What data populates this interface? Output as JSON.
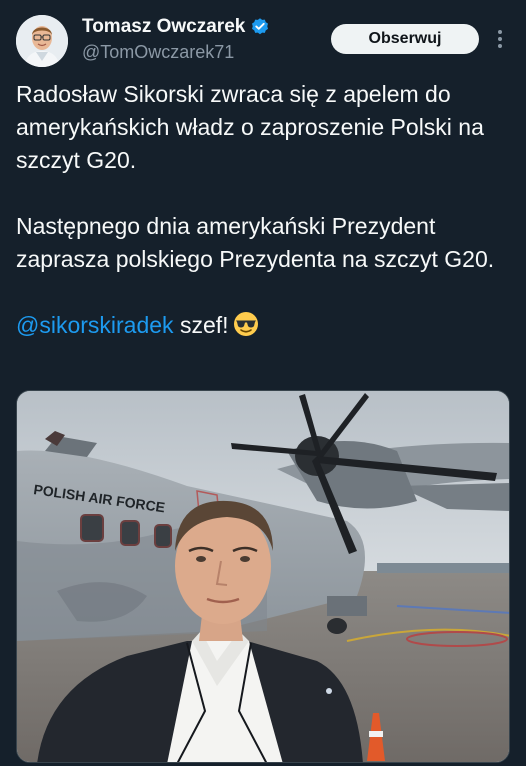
{
  "author": {
    "name": "Tomasz Owczarek",
    "handle": "@TomOwczarek71",
    "verified": true,
    "verified_color": "#1d9bf0"
  },
  "actions": {
    "follow_label": "Obserwuj"
  },
  "tweet": {
    "paragraph1": "Radosław Sikorski zwraca się z apelem do amerykańskich władz o zaproszenie Polski na szczyt G20.",
    "paragraph2": "Następnego dnia amerykański Prezydent zaprasza polskiego Prezydenta na szczyt G20.",
    "mention": "@sikorskiradek",
    "paragraph3_rest": " szef!",
    "emoji": "smiling-face-with-sunglasses"
  },
  "media": {
    "aircraft_text": "POLISH AIR FORCE"
  },
  "colors": {
    "background": "#15202b",
    "text": "#f7f9f9",
    "secondary_text": "#8b98a5",
    "link": "#1d9bf0",
    "button_bg": "#eff3f4"
  }
}
